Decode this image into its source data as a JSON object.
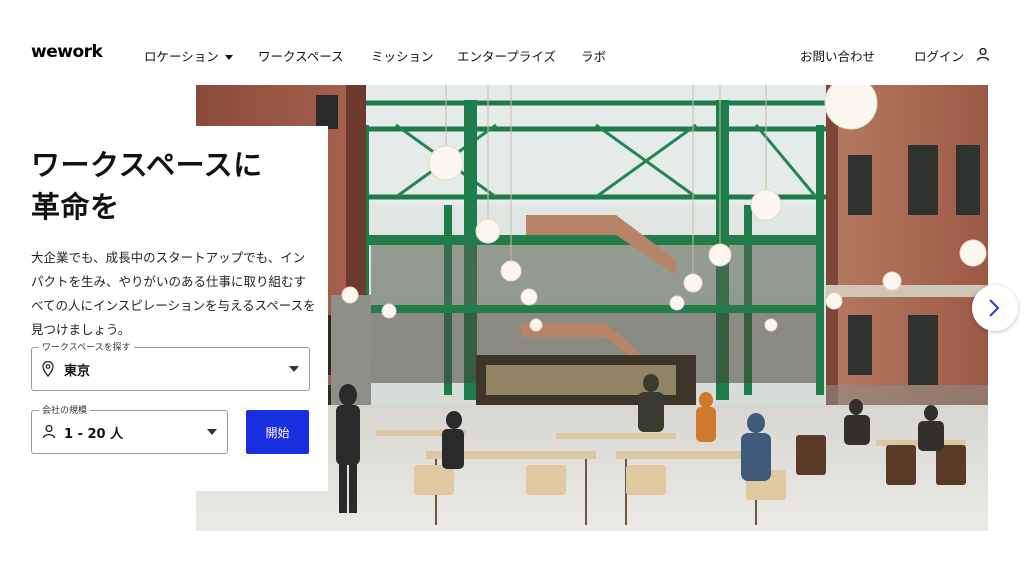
{
  "brand": {
    "logo": "wework",
    "accent": "#1a2fe0"
  },
  "nav": {
    "location_label": "ロケーション",
    "workspace_label": "ワークスペース",
    "mission_label": "ミッション",
    "enterprise_label": "エンタープライズ",
    "labs_label": "ラボ",
    "contact_label": "お問い合わせ",
    "login_label": "ログイン",
    "user_icon": "user-icon"
  },
  "hero": {
    "headline_line1": "ワークスペースに",
    "headline_line2": "革命を",
    "description": "大企業でも、成長中のスタートアップでも、インパクトを生み、やりがいのある仕事に取り組むすべての人にインスピレーションを与えるスペースを見つけましょう。",
    "next_icon": "chevron-right-icon"
  },
  "search": {
    "location_field_label": "ワークスペースを探す",
    "location_value": "東京",
    "location_icon": "location-pin-icon",
    "size_field_label": "会社の規模",
    "size_value": "1 - 20 人",
    "size_icon": "person-icon",
    "start_button_label": "開始"
  }
}
